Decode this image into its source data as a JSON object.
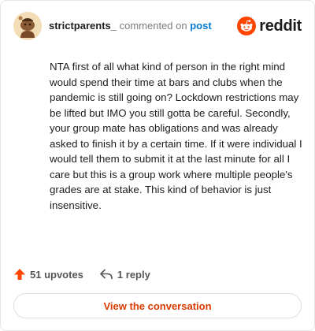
{
  "header": {
    "username": "strictparents_",
    "commented_text": "commented on",
    "post_link": "post",
    "brand": "reddit",
    "avatar_icon": "snoo-avatar-icon",
    "brand_color": "#ff4500"
  },
  "comment": {
    "body": "NTA first of all what kind of person in the right mind would spend their time at bars and clubs when the pandemic is still going on? Lockdown restrictions may be lifted but IMO you still gotta be careful. Secondly, your group mate has obligations and was already asked to finish it by a certain time. If it were individual I would tell them to submit it at the last minute for all I care but this is a group work where multiple people's grades are at stake. This kind of behavior is just insensitive."
  },
  "footer": {
    "upvotes": "51 upvotes",
    "replies": "1 reply",
    "upvote_icon": "upvote-arrow-icon",
    "reply_icon": "reply-arrow-icon"
  },
  "cta": {
    "label": "View the conversation",
    "color": "#d93a00"
  }
}
